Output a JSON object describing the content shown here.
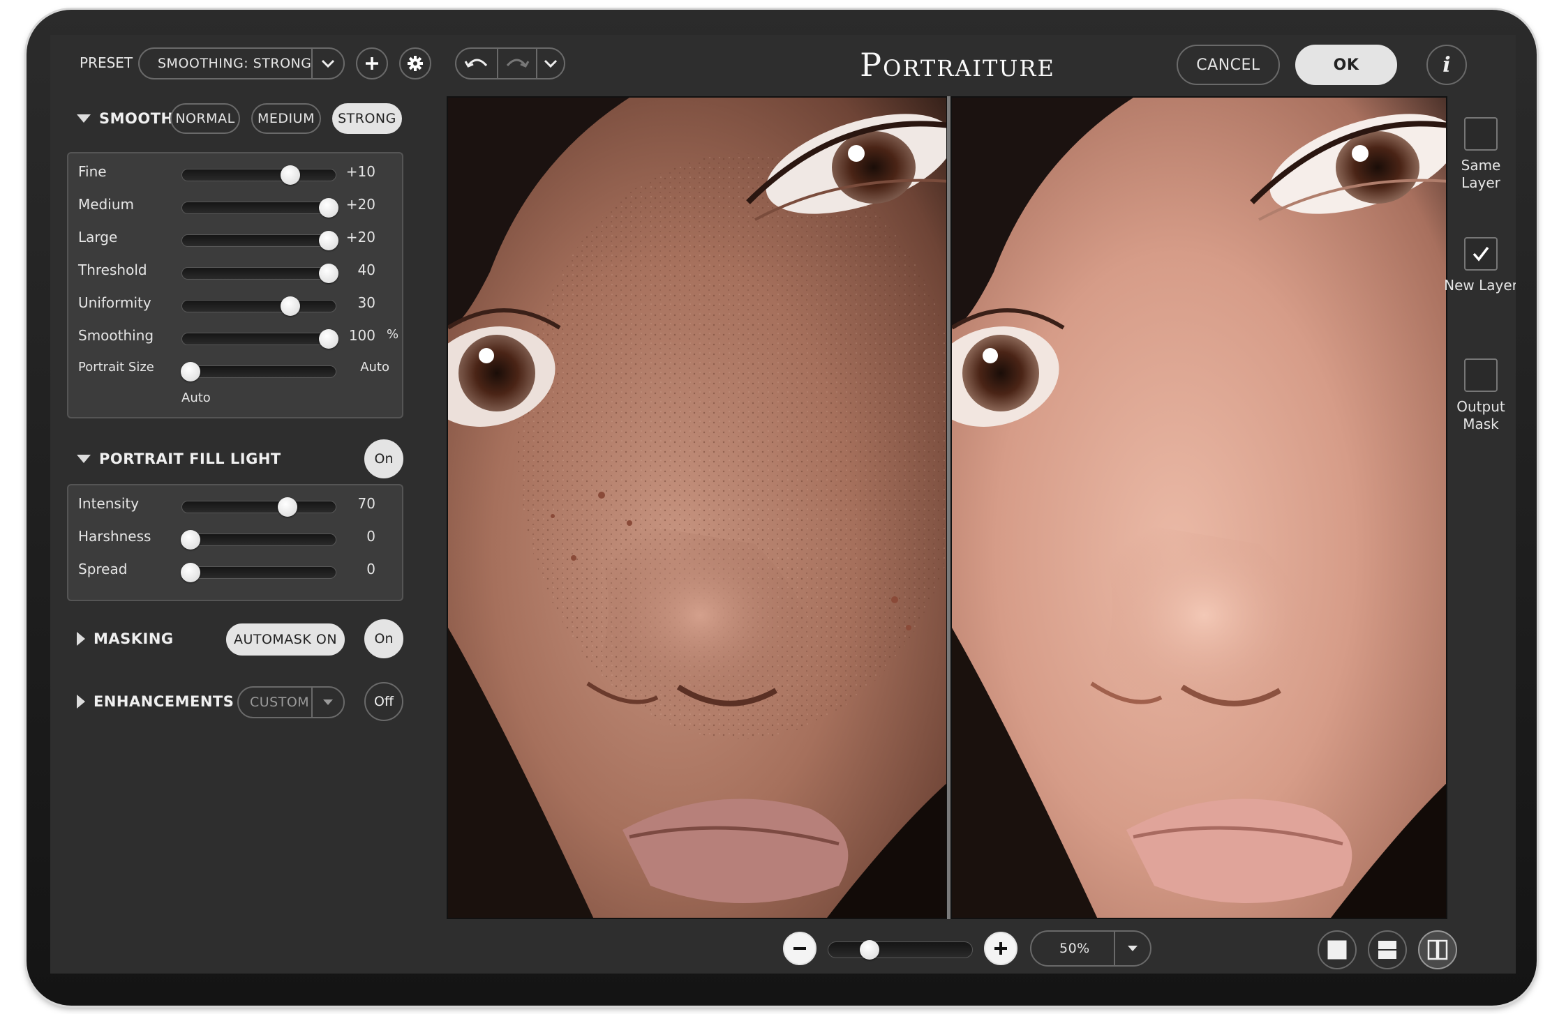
{
  "header": {
    "preset_label": "PRESET",
    "preset_value": "SMOOTHING: STRONG",
    "title": "Portraiture",
    "cancel_label": "CANCEL",
    "ok_label": "OK",
    "info_label": "i"
  },
  "smoothing": {
    "title": "SMOOTHING",
    "modes": [
      "NORMAL",
      "MEDIUM",
      "STRONG"
    ],
    "active_mode": "STRONG",
    "sliders": [
      {
        "label": "Fine",
        "value": "+10",
        "level": 0.72
      },
      {
        "label": "Medium",
        "value": "+20",
        "level": 1.0
      },
      {
        "label": "Large",
        "value": "+20",
        "level": 1.0
      },
      {
        "label": "Threshold",
        "value": "40",
        "level": 1.0
      },
      {
        "label": "Uniformity",
        "value": "30",
        "level": 0.72
      },
      {
        "label": "Smoothing",
        "value": "100",
        "level": 1.0,
        "unit": "%"
      },
      {
        "label": "Portrait Size",
        "value": "Auto",
        "level": 0.0
      }
    ],
    "portrait_size_note": "Auto"
  },
  "fill_light": {
    "title": "PORTRAIT FILL LIGHT",
    "toggle": "On",
    "sliders": [
      {
        "label": "Intensity",
        "value": "70",
        "level": 0.7
      },
      {
        "label": "Harshness",
        "value": "0",
        "level": 0.0
      },
      {
        "label": "Spread",
        "value": "0",
        "level": 0.0
      }
    ]
  },
  "masking": {
    "title": "MASKING",
    "automask_label": "AUTOMASK ON",
    "toggle": "On"
  },
  "enhancements": {
    "title": "ENHANCEMENTS",
    "preset_value": "CUSTOM",
    "toggle": "Off"
  },
  "output": {
    "same_layer": {
      "label": "Same Layer",
      "checked": false
    },
    "new_layer": {
      "label": "New Layer",
      "checked": true
    },
    "output_mask": {
      "label": "Output Mask",
      "checked": false
    }
  },
  "zoom": {
    "value": "50%",
    "level": 0.25
  }
}
